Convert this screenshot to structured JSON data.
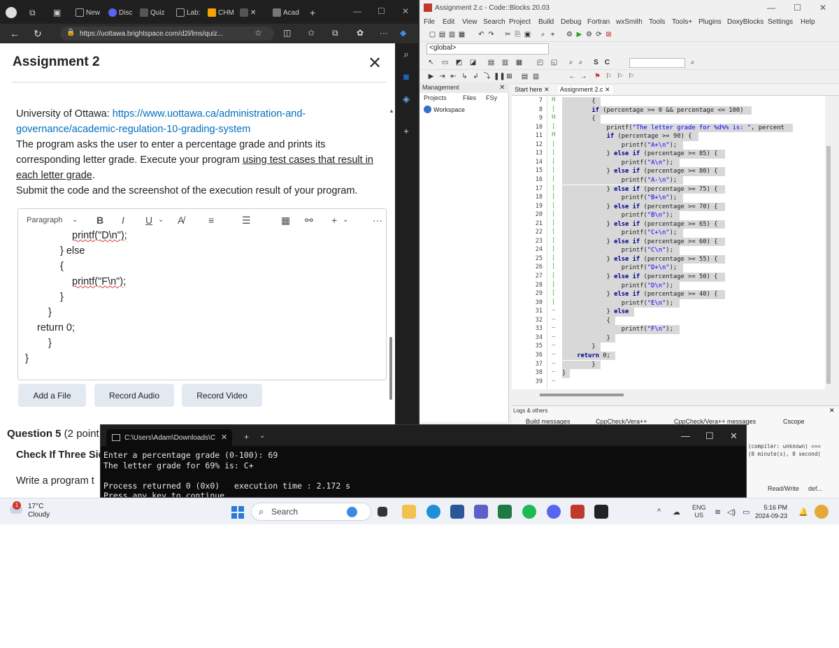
{
  "edge": {
    "tabs": [
      "New",
      "Disc",
      "Quiz",
      "Lab:",
      "CHM",
      "Acad"
    ],
    "url": "https://uottawa.brightspace.com/d2l/lms/quiz...",
    "dialog_title": "Assignment 2",
    "close_glyph": "✕",
    "desc_prefix": "University of Ottawa: ",
    "desc_link": "https://www.uottawa.ca/administration-and-governance/academic-regulation-10-grading-system",
    "desc_p1": "The program asks the user to enter a percentage grade and prints its corresponding letter grade. Execute your program ",
    "desc_p1_underline": "using test cases that result in each letter grade",
    "desc_p1_end": ".",
    "desc_p2": "Submit the code and the screenshot of the execution result of your program.",
    "toolbar": {
      "paragraph": "Paragraph",
      "bold": "B",
      "italic": "I",
      "underline": "U",
      "more": "+",
      "ellipsis": "···"
    },
    "code_lines": [
      "printf(\"D\\n\");",
      "} else",
      "{",
      "printf(\"F\\n\");",
      "}",
      "}",
      "return 0;",
      "}",
      "}"
    ],
    "buttons": {
      "add_file": "Add a File",
      "record_audio": "Record Audio",
      "record_video": "Record Video"
    },
    "question_label": "Question 5",
    "question_points": " (2 point",
    "question_title": "Check If Three Sid",
    "question_write": "Write a program t"
  },
  "codeblocks": {
    "title": "Assignment 2.c - Code::Blocks 20.03",
    "menu": [
      "File",
      "Edit",
      "View",
      "Search",
      "Project",
      "Build",
      "Debug",
      "Fortran",
      "wxSmith",
      "Tools",
      "Tools+",
      "Plugins",
      "DoxyBlocks",
      "Settings",
      "Help"
    ],
    "globals": "<global>",
    "management": "Management",
    "mgmt_tabs": [
      "Projects",
      "Files",
      "FSy"
    ],
    "workspace": "Workspace",
    "editor_tabs": [
      "Start here",
      "Assignment 2.c"
    ],
    "line_numbers": [
      "7",
      "8",
      "9",
      "10",
      "11",
      "12",
      "13",
      "14",
      "15",
      "16",
      "17",
      "18",
      "19",
      "20",
      "21",
      "22",
      "23",
      "24",
      "25",
      "26",
      "27",
      "28",
      "29",
      "30",
      "31",
      "32",
      "33",
      "34",
      "35",
      "36",
      "37",
      "38",
      "39"
    ],
    "code": [
      "        {",
      "        if (percentage >= 0 && percentage <= 100)",
      "        {",
      "            printf(\"The letter grade for %d%% is: \", percent",
      "            if (percentage >= 90) {",
      "                printf(\"A+\\n\");",
      "            } else if (percentage >= 85) {",
      "                printf(\"A\\n\");",
      "            } else if (percentage >= 80) {",
      "                printf(\"A-\\n\");",
      "            } else if (percentage >= 75) {",
      "                printf(\"B+\\n\");",
      "            } else if (percentage >= 70) {",
      "                printf(\"B\\n\");",
      "            } else if (percentage >= 65) {",
      "                printf(\"C+\\n\");",
      "            } else if (percentage >= 60) {",
      "                printf(\"C\\n\");",
      "            } else if (percentage >= 55) {",
      "                printf(\"D+\\n\");",
      "            } else if (percentage >= 50) {",
      "                printf(\"D\\n\");",
      "            } else if (percentage >= 40) {",
      "                printf(\"E\\n\");",
      "            } else",
      "            {",
      "                printf(\"F\\n\");",
      "            }",
      "        }",
      "    return 0;",
      "        }",
      "}",
      ""
    ],
    "logs_label": "Logs & others",
    "log_tabs": [
      "Build messages",
      "CppCheck/Vera++",
      "CppCheck/Vera++ messages",
      "Cscope"
    ],
    "log_text": "(compiler: unknown) ===\n(0 minute(s), 0 second(",
    "status": [
      "Read/Write",
      "def..."
    ]
  },
  "terminal": {
    "tab_title": "C:\\Users\\Adam\\Downloads\\C",
    "lines": [
      "Enter a percentage grade (0-100): 69",
      "The letter grade for 69% is: C+",
      "",
      "Process returned 0 (0x0)   execution time : 2.172 s",
      "Press any key to continue."
    ]
  },
  "taskbar": {
    "weather_temp": "17°C",
    "weather_cond": "Cloudy",
    "weather_badge": "1",
    "search": "Search",
    "lang1": "ENG",
    "lang2": "US",
    "time": "5:16 PM",
    "date": "2024-09-23"
  },
  "colors": {
    "link": "#006fbf",
    "terminal_bg": "#0c0c0c",
    "taskbar_bg": "#eef1f6",
    "code_highlight": "#d8d8d8",
    "keyword": "#00008b",
    "string": "#0000ff"
  }
}
